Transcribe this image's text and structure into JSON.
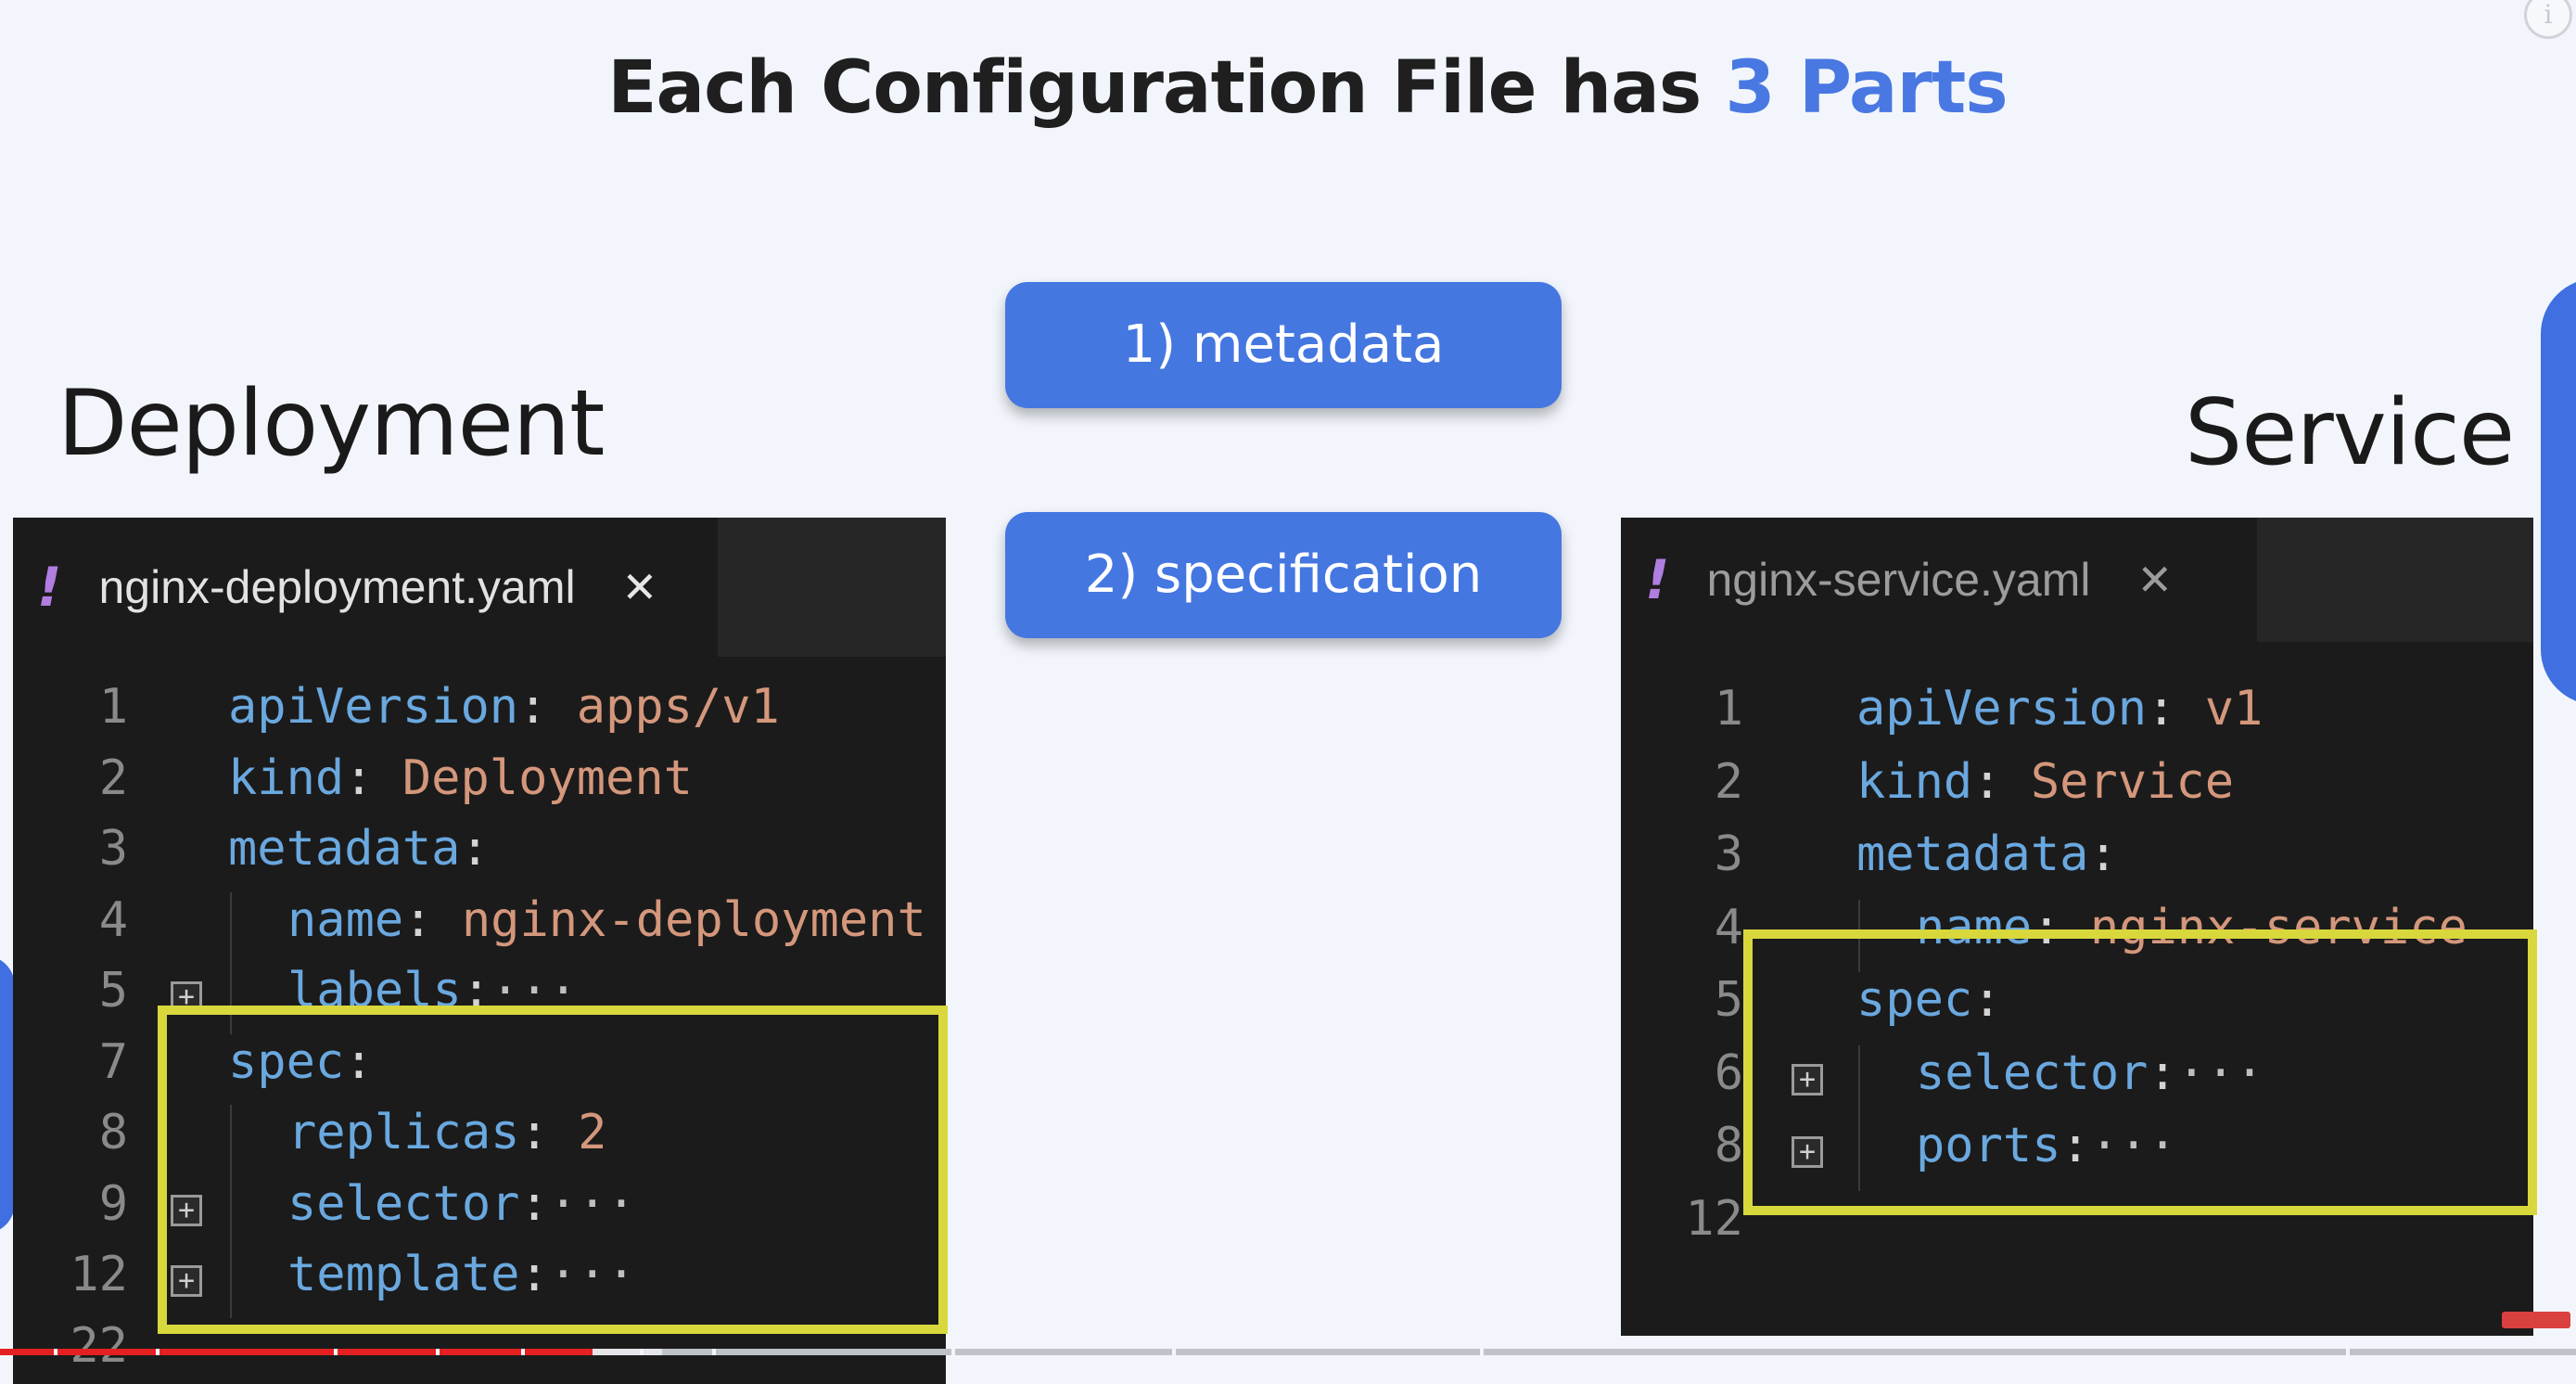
{
  "slide": {
    "title_main": "Each Configuration File has ",
    "title_accent": "3 Parts",
    "accent_color": "#4a78e2"
  },
  "sections": {
    "left_title": "Deployment",
    "right_title": "Service"
  },
  "parts": [
    {
      "label": "1) metadata"
    },
    {
      "label": "2) specification"
    }
  ],
  "deployment_editor": {
    "tab_warning": "!",
    "tab_name": "nginx-deployment.yaml",
    "tab_close": "✕",
    "lines": [
      {
        "num": "1",
        "key": "apiVersion",
        "sep": ": ",
        "value": "apps/v1"
      },
      {
        "num": "2",
        "key": "kind",
        "sep": ": ",
        "value": "Deployment"
      },
      {
        "num": "3",
        "key": "metadata",
        "sep": ":",
        "value": ""
      },
      {
        "num": "4",
        "key": "name",
        "sep": ": ",
        "value": "nginx-deployment"
      },
      {
        "num": "5",
        "key": "labels",
        "sep": ":",
        "value": "···"
      },
      {
        "num": "7",
        "key": "spec",
        "sep": ":",
        "value": ""
      },
      {
        "num": "8",
        "key": "replicas",
        "sep": ": ",
        "value": "2"
      },
      {
        "num": "9",
        "key": "selector",
        "sep": ":",
        "value": "···"
      },
      {
        "num": "12",
        "key": "template",
        "sep": ":",
        "value": "···"
      },
      {
        "num": "22",
        "key": "",
        "sep": "",
        "value": ""
      }
    ]
  },
  "service_editor": {
    "tab_warning": "!",
    "tab_name": "nginx-service.yaml",
    "tab_close": "✕",
    "lines": [
      {
        "num": "1",
        "key": "apiVersion",
        "sep": ": ",
        "value": "v1"
      },
      {
        "num": "2",
        "key": "kind",
        "sep": ": ",
        "value": "Service"
      },
      {
        "num": "3",
        "key": "metadata",
        "sep": ":",
        "value": ""
      },
      {
        "num": "4",
        "key": "name",
        "sep": ": ",
        "value": "nginx-service"
      },
      {
        "num": "5",
        "key": "spec",
        "sep": ":",
        "value": ""
      },
      {
        "num": "6",
        "key": "selector",
        "sep": ":",
        "value": "···"
      },
      {
        "num": "8",
        "key": "ports",
        "sep": ":",
        "value": "···"
      },
      {
        "num": "12",
        "key": "",
        "sep": "",
        "value": ""
      }
    ]
  },
  "icons": {
    "info": "i",
    "fold": "+"
  },
  "colors": {
    "highlight": "#d8d83c",
    "pill_bg": "#4577e1",
    "yaml_key": "#6aa8df",
    "yaml_value": "#d4977c"
  },
  "video": {
    "played_fraction": 0.23,
    "loaded_fraction": 0.257
  }
}
